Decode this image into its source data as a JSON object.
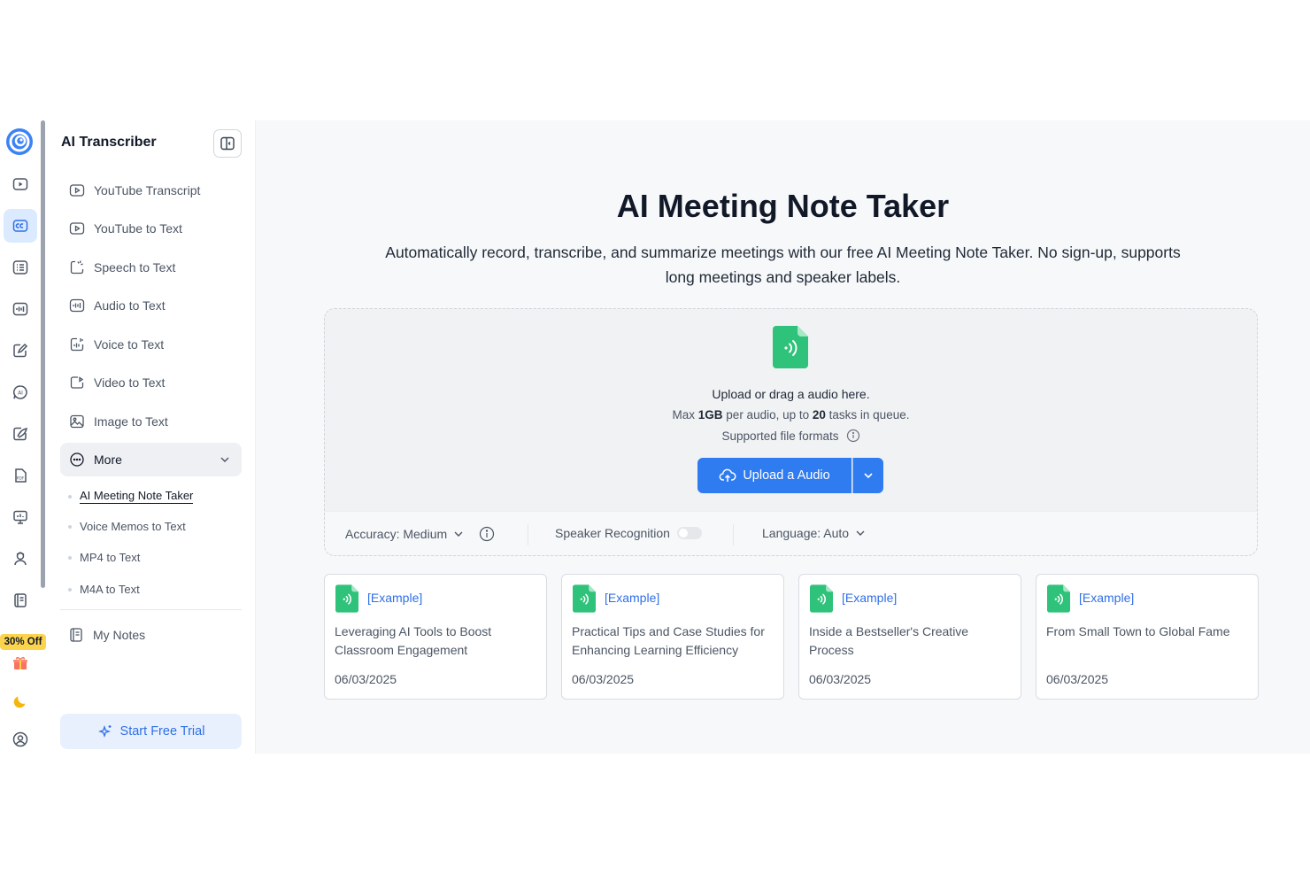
{
  "sidebar": {
    "title": "AI Transcriber",
    "items": [
      {
        "label": "YouTube Transcript",
        "icon": "youtube-icon"
      },
      {
        "label": "YouTube to Text",
        "icon": "youtube-icon"
      },
      {
        "label": "Speech to Text",
        "icon": "speech-icon"
      },
      {
        "label": "Audio to Text",
        "icon": "audio-wave-icon"
      },
      {
        "label": "Voice to Text",
        "icon": "voice-icon"
      },
      {
        "label": "Video to Text",
        "icon": "video-icon"
      },
      {
        "label": "Image to Text",
        "icon": "image-icon"
      }
    ],
    "more": {
      "label": "More",
      "icon": "more-icon"
    },
    "sub_items": [
      {
        "label": "AI Meeting Note Taker",
        "active": true
      },
      {
        "label": "Voice Memos to Text",
        "active": false
      },
      {
        "label": "MP4 to Text",
        "active": false
      },
      {
        "label": "M4A to Text",
        "active": false
      }
    ],
    "my_notes": "My Notes",
    "trial_button": "Start Free Trial"
  },
  "rail": {
    "promo": "30% Off"
  },
  "main": {
    "title": "AI Meeting Note Taker",
    "subtitle": "Automatically record, transcribe, and summarize meetings with our free AI Meeting Note Taker. No sign-up, supports long meetings and speaker labels.",
    "upload": {
      "line1": "Upload or drag a audio here.",
      "max_prefix": "Max ",
      "max_size": "1GB",
      "max_mid": " per audio, up to ",
      "max_tasks": "20",
      "max_suffix": " tasks in queue.",
      "formats": "Supported file formats",
      "button": "Upload a Audio"
    },
    "options": {
      "accuracy": "Accuracy: Medium",
      "speaker": "Speaker Recognition",
      "speaker_enabled": false,
      "language": "Language: Auto"
    },
    "examples": [
      {
        "tag": "[Example]",
        "title": "Leveraging AI Tools to Boost Classroom Engagement",
        "date": "06/03/2025"
      },
      {
        "tag": "[Example]",
        "title": "Practical Tips and Case Studies for Enhancing Learning Efficiency",
        "date": "06/03/2025"
      },
      {
        "tag": "[Example]",
        "title": "Inside a Bestseller's Creative Process",
        "date": "06/03/2025"
      },
      {
        "tag": "[Example]",
        "title": "From Small Town to Global Fame",
        "date": "06/03/2025"
      }
    ]
  },
  "colors": {
    "accent": "#2f7bf0",
    "file_green": "#2fc27a",
    "promo": "#fcd34d"
  }
}
